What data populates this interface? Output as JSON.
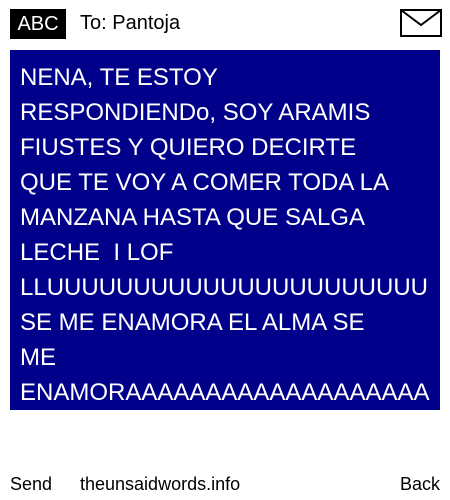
{
  "header": {
    "mode_label": "ABC",
    "recipient": "To: Pantoja",
    "envelope_icon": "envelope-icon"
  },
  "message": {
    "lines": [
      "NENA, TE ESTOY",
      "RESPONDIENDo, SOY ARAMIS",
      "FIUSTES Y QUIERO DECIRTE",
      "QUE TE VOY A COMER TODA LA",
      "MANZANA HASTA QUE SALGA",
      "LECHE  I LOF",
      "LLUUUUUUUUUUUUUUUUUUUUUU",
      "SE ME ENAMORA EL ALMA SE",
      "ME",
      "ENAMORAAAAAAAAAAAAAAAAAAA"
    ]
  },
  "softkeys": {
    "left": "Send",
    "center": "theunsaidwords.info",
    "right": "Back"
  },
  "colors": {
    "message_background": "#00008b",
    "message_text": "#ffffff",
    "badge_background": "#000000"
  }
}
